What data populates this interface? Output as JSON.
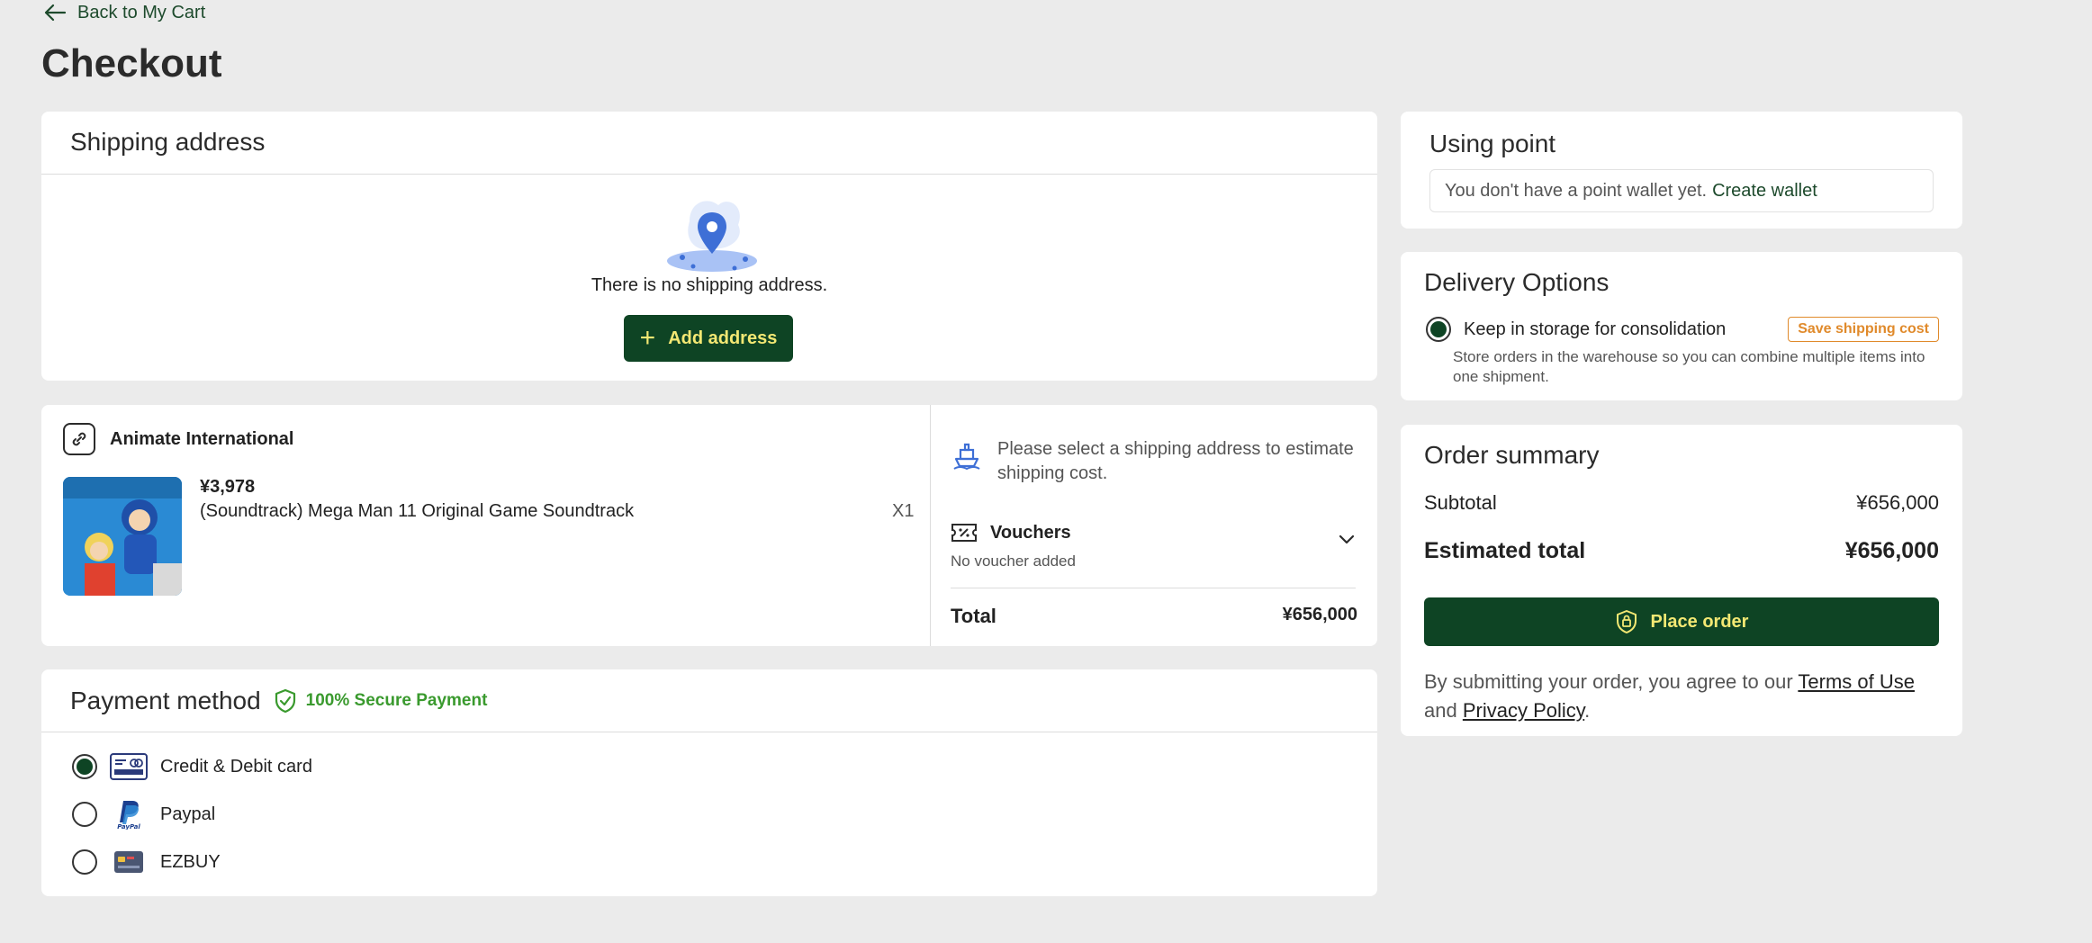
{
  "nav": {
    "back_label": "Back to My Cart"
  },
  "page": {
    "title": "Checkout"
  },
  "shipping": {
    "title": "Shipping address",
    "empty_text": "There is no shipping address.",
    "add_button": "Add address"
  },
  "order_item": {
    "store_name": "Animate International",
    "price": "¥3,978",
    "name": "(Soundtrack) Mega Man 11 Original Game Soundtrack",
    "qty": "X1",
    "shipping_hint": "Please select a shipping address to estimate shipping cost.",
    "vouchers_title": "Vouchers",
    "vouchers_sub": "No voucher added",
    "total_label": "Total",
    "total_value": "¥656,000"
  },
  "payment": {
    "title": "Payment method",
    "secure_label": "100% Secure Payment",
    "options": [
      {
        "label": "Credit & Debit card",
        "selected": true,
        "icon": "credit-card-icon"
      },
      {
        "label": "Paypal",
        "selected": false,
        "icon": "paypal-icon"
      },
      {
        "label": "EZBUY",
        "selected": false,
        "icon": "ezbuy-card-icon"
      }
    ]
  },
  "point": {
    "title": "Using point",
    "message": "You don't have a point wallet yet.",
    "link": "Create wallet"
  },
  "delivery": {
    "title": "Delivery Options",
    "option_label": "Keep in storage for consolidation",
    "badge": "Save shipping cost",
    "description": "Store orders in the warehouse so you can combine multiple items into one shipment."
  },
  "summary": {
    "title": "Order summary",
    "subtotal_label": "Subtotal",
    "subtotal_value": "¥656,000",
    "estimated_label": "Estimated total",
    "estimated_value": "¥656,000",
    "place_order": "Place order",
    "terms_prefix": "By submitting your order, you agree to our",
    "terms_link": "Terms of Use",
    "terms_and": "and",
    "privacy_link": "Privacy Policy",
    "terms_end": "."
  },
  "colors": {
    "primary": "#0e4424",
    "button_text": "#f3e873",
    "secure_green": "#3a9a2e",
    "badge_orange": "#e08a2b",
    "background": "#ebebeb"
  }
}
